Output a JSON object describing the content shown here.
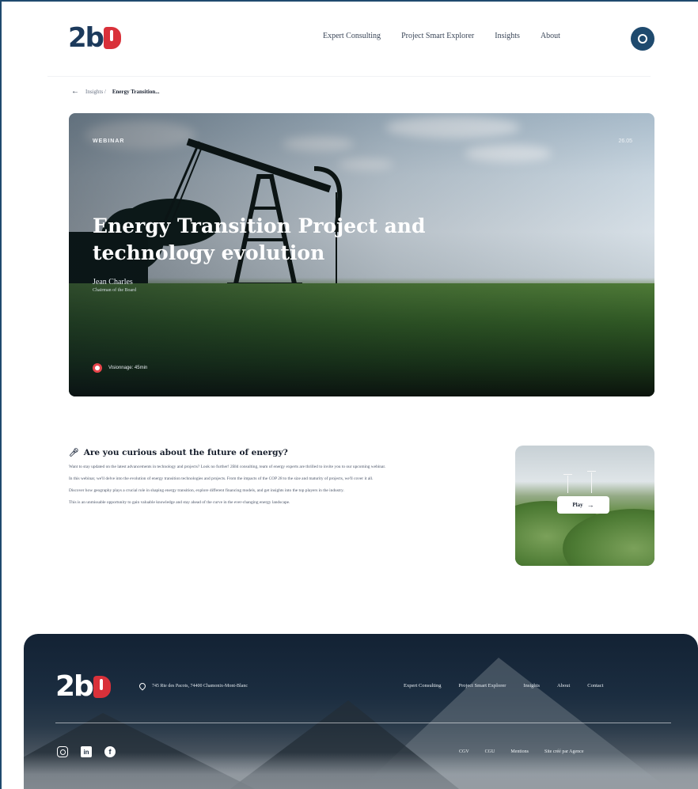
{
  "header": {
    "logo_text": "2b",
    "nav": [
      "Expert Consulting",
      "Project Smart Explorer",
      "Insights",
      "About"
    ]
  },
  "breadcrumb": {
    "back_icon": "arrow-left-icon",
    "parent": "Insights /",
    "current": "Energy Transition..."
  },
  "hero": {
    "tag": "WEBINAR",
    "date": "26.05",
    "title": "Energy Transition Project and technology evolution",
    "speaker_name": "Jean Charles",
    "speaker_role": "Chairman of the Board",
    "duration": "Visionnage: 45min"
  },
  "content": {
    "heading_icon": "microphone-icon",
    "heading": "Are you curious about the future of energy?",
    "paragraphs": [
      "Want to stay updated on the latest advancements in technology and projects? Look no further! 2Bld consulting, team of energy experts are thrilled to invite you to our upcoming webinar.",
      "In this webinar, we'll delve into the evolution of energy transition technologies and projects. From the impacts of the COP 28 to the size and maturity of projects, we'll cover it all.",
      "Discover how geography plays a crucial role in shaping energy transition, explore different financing models, and get insights into the top players in the industry.",
      "This is an unmissable opportunity to gain valuable knowledge and stay ahead of the curve in the ever-changing energy landscape."
    ],
    "video_button": "Play"
  },
  "footer": {
    "logo_text": "2b",
    "address": "745 Rte des Pacots, 74400 Chamonix-Mont-Blanc",
    "nav": [
      "Expert Consulting",
      "Project Smart Explorer",
      "Insights",
      "About",
      "Contact"
    ],
    "legal": [
      "CGV",
      "CGU",
      "Mentions",
      "Site créé par Agence"
    ],
    "socials": [
      "instagram-icon",
      "linkedin-icon",
      "facebook-icon"
    ]
  },
  "colors": {
    "brand_navy": "#1f4a6e",
    "brand_red": "#d9313a"
  }
}
